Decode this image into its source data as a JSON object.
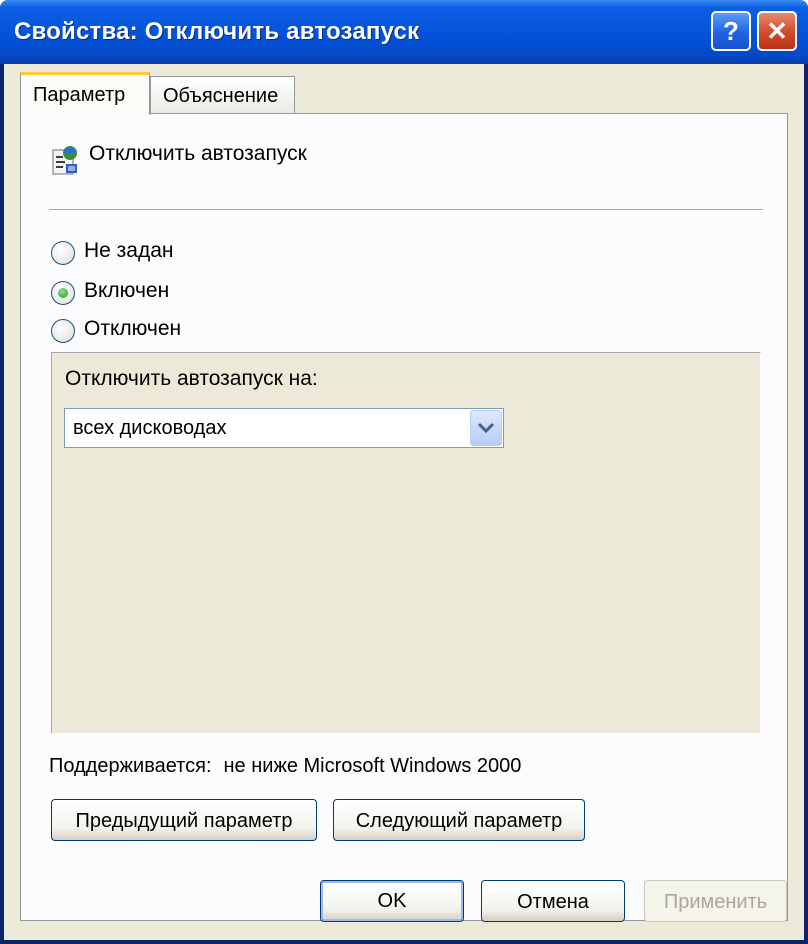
{
  "window": {
    "title": "Свойства: Отключить автозапуск",
    "help_label": "?",
    "close_label": "✕"
  },
  "tabs": [
    {
      "label": "Параметр",
      "active": true
    },
    {
      "label": "Объяснение",
      "active": false
    }
  ],
  "policy": {
    "name": "Отключить автозапуск",
    "icon": "policy-setting-icon"
  },
  "state_options": [
    {
      "label": "Не задан",
      "selected": false
    },
    {
      "label": "Включен",
      "selected": true
    },
    {
      "label": "Отключен",
      "selected": false
    }
  ],
  "options": {
    "label": "Отключить автозапуск на:",
    "dropdown_value": "всех дисководах"
  },
  "supported": {
    "label": "Поддерживается:",
    "value": "не ниже Microsoft Windows 2000"
  },
  "nav_buttons": {
    "previous": "Предыдущий параметр",
    "next": "Следующий параметр"
  },
  "dialog_buttons": {
    "ok": "OK",
    "cancel": "Отмена",
    "apply": "Применить",
    "apply_enabled": false
  },
  "colors": {
    "titlebar": "#0454dc",
    "dialog_background": "#ece9d8",
    "tab_highlight": "#ffc83c",
    "radio_dot": "#21a121"
  }
}
